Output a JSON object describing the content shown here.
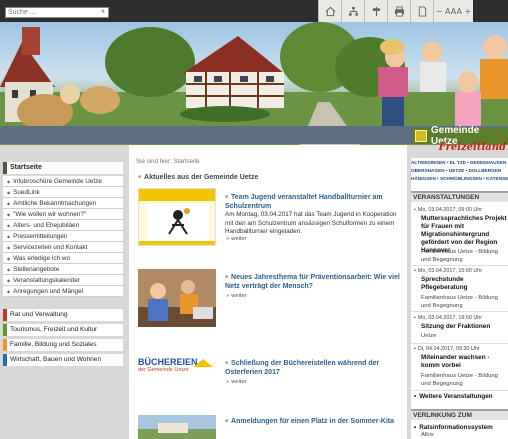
{
  "search": {
    "placeholder": "Suche ...",
    "button": "»"
  },
  "toolbar": {
    "font_size_label": "− AAA +"
  },
  "logo": {
    "name": "Gemeinde Uetze",
    "slogan": "Freizeitland"
  },
  "breadcrumb": "Sie sind hier: Startseite",
  "leftnav": {
    "active": "Startseite",
    "items": [
      "Infobroschüre Gemeinde Uetze",
      "SuedLink",
      "Amtliche Bekanntmachungen",
      "\"Wie wollen wir wohnen?\"",
      "Alters- und Ehejubiläen",
      "Pressemitteilungen",
      "Servicezeiten und Kontakt",
      "Was erledige ich wo",
      "Stellenangebote",
      "Veranstaltungskalender",
      "Anregungen und Mängel"
    ],
    "categories": [
      {
        "label": "Rat und Verwaltung",
        "color": "#c0392b"
      },
      {
        "label": "Tourismus, Freizeit und Kultur",
        "color": "#5b9b2a"
      },
      {
        "label": "Familie, Bildung und Soziales",
        "color": "#e89a2c"
      },
      {
        "label": "Wirtschaft, Bauen und Wohnen",
        "color": "#1f6fb3"
      }
    ]
  },
  "news": {
    "heading": "Aktuelles aus der Gemeinde Uetze",
    "more": "weiter",
    "articles": [
      {
        "title": "Team Jugend veranstaltet Handballturnier am Schulzentrum",
        "body": "Am Montag, 03.04.2017 hat das Team Jugend in Kooperation mit den am Schulzentrum ansässigen Schulformen zu einem Handballturnier eingeladen."
      },
      {
        "title": "Neues Jahresthema für Präventionsarbeit: Wie viel Netz verträgt der Mensch?",
        "body": ""
      },
      {
        "title": "Schließung der Büchereistellen während der Osterferien 2017",
        "body": ""
      },
      {
        "title": "Anmeldungen für einen Platz in der Sommer-Kita",
        "body": ""
      }
    ],
    "library_logo": {
      "line1": "BÜCHEREIEN",
      "line2": "der Gemeinde Uetze"
    }
  },
  "places": [
    "ALTWEDINGEN • EL TZE • DEDENHAUSEN",
    "OBERSHAGEN • UETZE • DOLLBERGEN",
    "HÄNIGSEN • SCHWÜBLINGSEN • KATENSEN"
  ],
  "events": {
    "heading": "VERANSTALTUNGEN",
    "items": [
      {
        "date": "Mo, 03.04.2017, 09:00 Uhr",
        "title": "Mutterssprachliches Projekt für Frauen mit Migrationshintergrund gefördert von der Region Hannover",
        "location": "Familienhaus Uetze - Bildung und Begegnung"
      },
      {
        "date": "Mo, 03.04.2017, 15:00 Uhr",
        "title": "Sprechstunde Pflegeberatung",
        "location": "Familienhaus Uetze - Bildung und Begegnung"
      },
      {
        "date": "Mo, 03.04.2017, 19:00 Uhr",
        "title": "Sitzung der Fraktionen",
        "location": "Uetze"
      },
      {
        "date": "Di, 04.04.2017, 09:30 Uhr",
        "title": "Miteinander wachsen - komm vorbei",
        "location": "Familienhaus Uetze - Bildung und Begegnung"
      }
    ],
    "more": "Weitere Veranstaltungen"
  },
  "links": {
    "heading": "VERLINKUNG ZUM",
    "items": [
      {
        "title": "Ratsinformationssystem",
        "sub": "Allris"
      }
    ]
  }
}
